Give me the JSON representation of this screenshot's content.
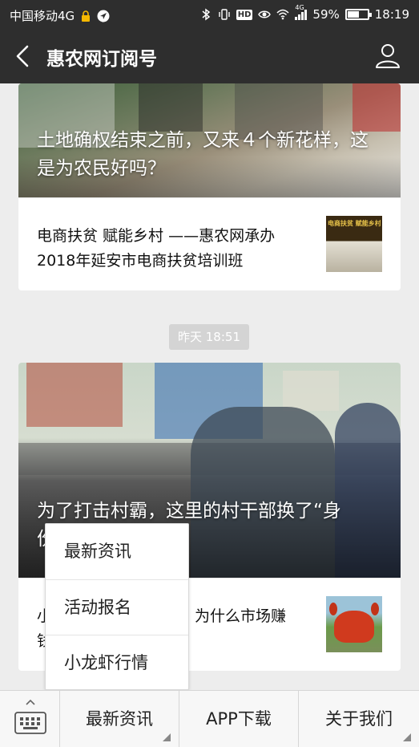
{
  "statusbar": {
    "carrier": "中国移动4G",
    "hd": "HD",
    "signal_label": "4G",
    "battery": "59%",
    "battery_level": 0.59,
    "time": "18:19"
  },
  "navbar": {
    "title": "惠农网订阅号"
  },
  "articles": [
    {
      "cover_title": "土地确权结束之前，又来４个新花样，这是为农民好吗？",
      "sub_title": "电商扶贫 赋能乡村 ——惠农网承办2018年延安市电商扶贫培训班",
      "thumb_text": "电商扶贫 赋能乡村"
    },
    {
      "cover_title_line1": "为了打击村霸，这里的村干部换了“身",
      "cover_title_line2": "份",
      "sub_title_line1_left": "小",
      "sub_title_line1_right": "为什么市场赚",
      "sub_title_line2": "钱"
    }
  ],
  "timestamp": "昨天 18:51",
  "popup_menu": {
    "items": [
      "最新资讯",
      "活动报名",
      "小龙虾行情"
    ]
  },
  "bottombar": {
    "tabs": [
      "最新资讯",
      "APP下载",
      "关于我们"
    ]
  }
}
